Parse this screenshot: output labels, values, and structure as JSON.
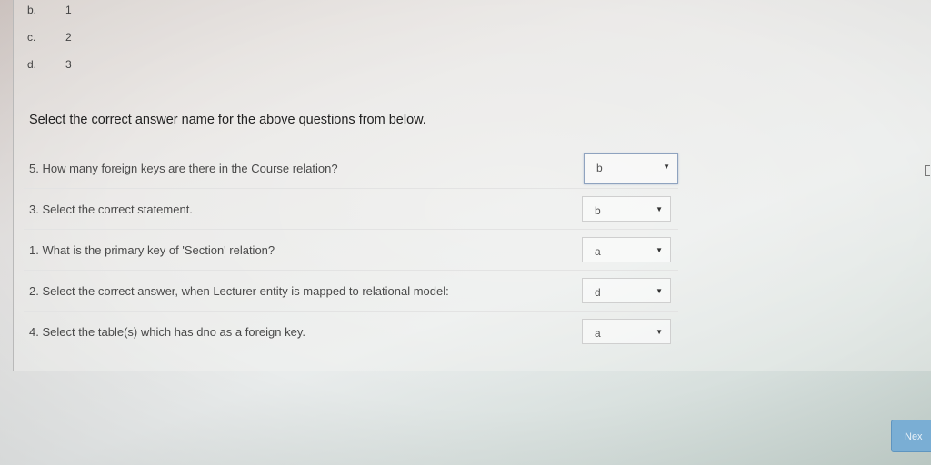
{
  "previous_question": {
    "options": [
      {
        "letter": "b.",
        "value": "1"
      },
      {
        "letter": "c.",
        "value": "2"
      },
      {
        "letter": "d.",
        "value": "3"
      }
    ]
  },
  "instruction": "Select the correct answer name for the above questions from below.",
  "matching": [
    {
      "question": "5. How many foreign keys are there in the Course relation?",
      "selected": "b"
    },
    {
      "question": "3. Select the correct statement.",
      "selected": "b"
    },
    {
      "question": "1. What is the primary key of 'Section' relation?",
      "selected": "a"
    },
    {
      "question": "2. Select the correct answer, when Lecturer entity is mapped to relational model:",
      "selected": "d"
    },
    {
      "question": "4. Select the table(s) which has dno as a foreign key.",
      "selected": "a"
    }
  ],
  "dropdown_arrow": "▼",
  "next_button": "Nex"
}
